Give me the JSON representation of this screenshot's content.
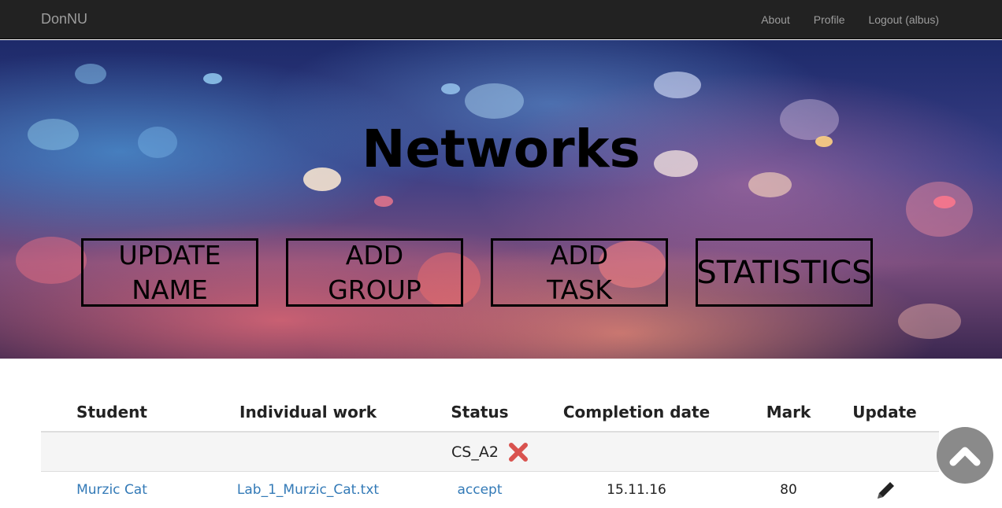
{
  "navbar": {
    "brand": "DonNU",
    "links": [
      "About",
      "Profile",
      "Logout (albus)"
    ]
  },
  "hero": {
    "title": "Networks",
    "buttons": [
      "UPDATE\nNAME",
      "ADD\nGROUP",
      "ADD\nTASK",
      "STATISTICS"
    ]
  },
  "table": {
    "headers": [
      "Student",
      "Individual work",
      "Status",
      "Completion date",
      "Mark",
      "Update"
    ],
    "group": {
      "label": "CS_A2",
      "icon": "delete-x-icon"
    },
    "rows": [
      {
        "student": "Murzic Cat",
        "work": "Lab_1_Murzic_Cat.txt",
        "status": "accept",
        "date": "15.11.16",
        "mark": "80",
        "update_icon": "pencil-icon"
      }
    ]
  },
  "scroll_top": {
    "icon": "chevron-up-icon"
  },
  "colors": {
    "navbar": "#222222",
    "link": "#337ab7",
    "delete": "#d9534f"
  }
}
